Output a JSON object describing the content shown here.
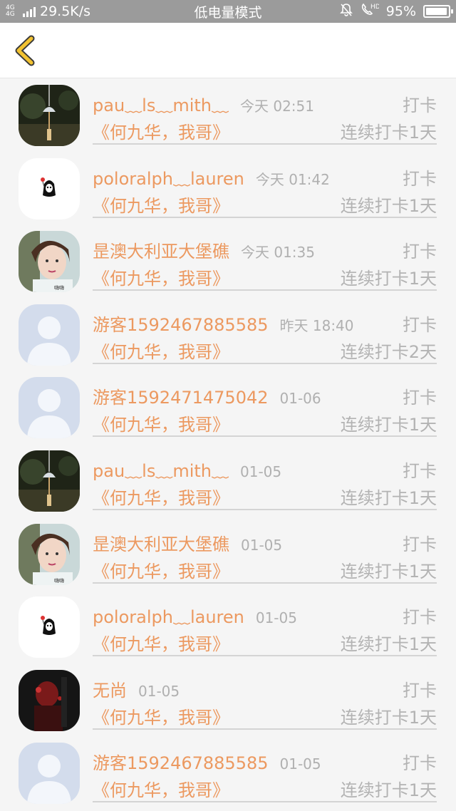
{
  "status_bar": {
    "network_type": "4G 4G",
    "speed": "29.5K/s",
    "mode": "低电量模式",
    "battery_percent": "95%",
    "battery_level": 0.95
  },
  "header": {
    "back_icon": "chevron-left-icon"
  },
  "colors": {
    "accent": "#ec9960",
    "muted": "#b3b3b3",
    "status_bar": "#9b9b9b"
  },
  "items": [
    {
      "name": "pau﹏ls﹏mith﹏",
      "time": "今天 02:51",
      "type": "打卡",
      "book": "《何九华，我哥》",
      "streak": "连续打卡1天",
      "avatar": "wind-chime"
    },
    {
      "name": "poloralph﹏lauren",
      "time": "今天 01:42",
      "type": "打卡",
      "book": "《何九华，我哥》",
      "streak": "连续打卡1天",
      "avatar": "ghost-sticker"
    },
    {
      "name": "昰澳大利亚大堡礁",
      "time": "今天 01:35",
      "type": "打卡",
      "book": "《何九华，我哥》",
      "streak": "连续打卡1天",
      "avatar": "boy-photo"
    },
    {
      "name": "游客1592467885585",
      "time": "昨天 18:40",
      "type": "打卡",
      "book": "《何九华，我哥》",
      "streak": "连续打卡2天",
      "avatar": "default-person"
    },
    {
      "name": "游客1592471475042",
      "time": "01-06",
      "type": "打卡",
      "book": "《何九华，我哥》",
      "streak": "连续打卡1天",
      "avatar": "default-person"
    },
    {
      "name": "pau﹏ls﹏mith﹏",
      "time": "01-05",
      "type": "打卡",
      "book": "《何九华，我哥》",
      "streak": "连续打卡1天",
      "avatar": "wind-chime"
    },
    {
      "name": "昰澳大利亚大堡礁",
      "time": "01-05",
      "type": "打卡",
      "book": "《何九华，我哥》",
      "streak": "连续打卡1天",
      "avatar": "boy-photo"
    },
    {
      "name": "poloralph﹏lauren",
      "time": "01-05",
      "type": "打卡",
      "book": "《何九华，我哥》",
      "streak": "连续打卡1天",
      "avatar": "ghost-sticker"
    },
    {
      "name": "无尚",
      "time": "01-05",
      "type": "打卡",
      "book": "《何九华，我哥》",
      "streak": "连续打卡1天",
      "avatar": "dark-photo"
    },
    {
      "name": "游客1592467885585",
      "time": "01-05",
      "type": "打卡",
      "book": "《何九华，我哥》",
      "streak": "连续打卡1天",
      "avatar": "default-person"
    }
  ]
}
